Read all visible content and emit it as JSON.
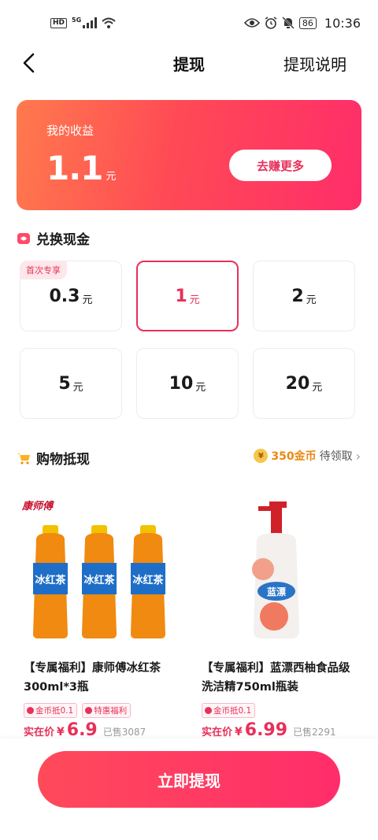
{
  "status_bar": {
    "hd": "HD",
    "network": "5G",
    "battery": "86",
    "time": "10:36"
  },
  "nav": {
    "title": "提现",
    "right_link": "提现说明"
  },
  "earnings": {
    "label": "我的收益",
    "value": "1.1",
    "unit": "元",
    "earn_more_button": "去赚更多"
  },
  "exchange": {
    "title": "兑换现金",
    "options": [
      {
        "value": "0.3",
        "unit": "元",
        "badge": "首次专享",
        "selected": false
      },
      {
        "value": "1",
        "unit": "元",
        "badge": "",
        "selected": true
      },
      {
        "value": "2",
        "unit": "元",
        "badge": "",
        "selected": false
      },
      {
        "value": "5",
        "unit": "元",
        "badge": "",
        "selected": false
      },
      {
        "value": "10",
        "unit": "元",
        "badge": "",
        "selected": false
      },
      {
        "value": "20",
        "unit": "元",
        "badge": "",
        "selected": false
      }
    ]
  },
  "shopping": {
    "title": "购物抵现",
    "coins_icon_text": "¥",
    "coins_amount": "350金币",
    "coins_status": "待领取",
    "products": [
      {
        "title": "【专属福利】康师傅冰红茶300ml*3瓶",
        "brand_logo": "康师傅",
        "product_label": "冰红茶",
        "tags": [
          "金币抵0.1",
          "特惠福利"
        ],
        "price_label": "实在价",
        "currency": "¥",
        "price": "6.9",
        "sold": "已售3087"
      },
      {
        "title": "【专属福利】蓝漂西柚食品级洗洁精750ml瓶装",
        "product_label": "蓝漂",
        "tags": [
          "金币抵0.1"
        ],
        "price_label": "实在价",
        "currency": "¥",
        "price": "6.99",
        "sold": "已售2291"
      }
    ]
  },
  "cta": {
    "label": "立即提现"
  },
  "colors": {
    "accent": "#e8305a",
    "card_gradient_start": "#ff7a4d",
    "card_gradient_end": "#ff2d6a",
    "coin": "#e98a10"
  }
}
